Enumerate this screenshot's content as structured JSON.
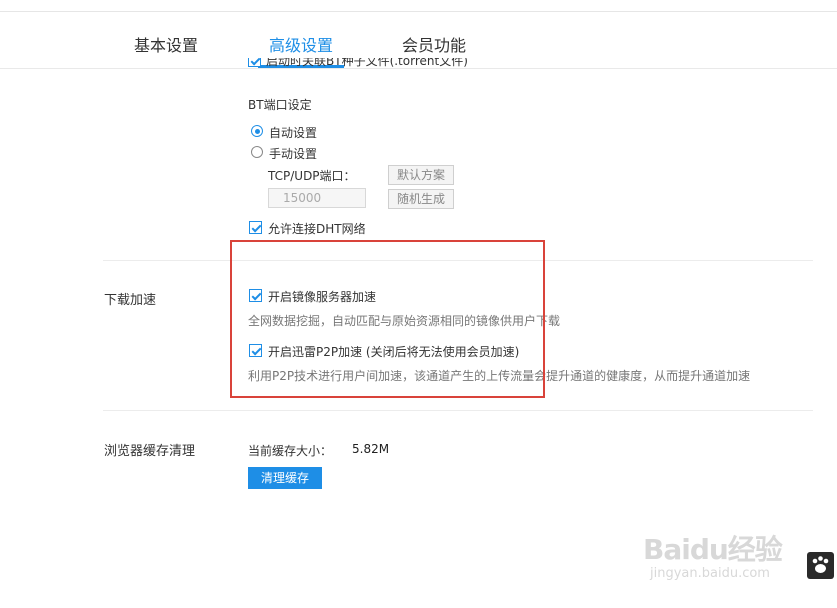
{
  "tabs": [
    {
      "label": "基本设置",
      "active": false
    },
    {
      "label": "高级设置",
      "active": true
    },
    {
      "label": "会员功能",
      "active": false
    }
  ],
  "bt": {
    "clipped_option": "启动时关联BT种子文件(.torrent文件)",
    "port_title": "BT端口设定",
    "radio_auto": "自动设置",
    "radio_manual": "手动设置",
    "selected_mode": "自动设置",
    "tcp_udp_label": "TCP/UDP端口：",
    "port_value": "15000",
    "default_button": "默认方案",
    "random_button": "随机生成",
    "dht_label": "允许连接DHT网络"
  },
  "download_accel": {
    "section_title": "下载加速",
    "mirror_label": "开启镜像服务器加速",
    "mirror_desc": "全网数据挖掘，自动匹配与原始资源相同的镜像供用户下载",
    "p2p_label": "开启迅雷P2P加速 (关闭后将无法使用会员加速)",
    "p2p_desc": "利用P2P技术进行用户间加速，该通道产生的上传流量会提升通道的健康度，从而提升通道加速"
  },
  "cache": {
    "section_title": "浏览器缓存清理",
    "size_label": "当前缓存大小：",
    "size_value": "5.82M",
    "clear_button": "清理缓存"
  },
  "watermark": {
    "brand": "Baidu经验",
    "url": "jingyan.baidu.com"
  },
  "colors": {
    "accent": "#1e8ee6",
    "highlight_box": "#d9433a"
  }
}
